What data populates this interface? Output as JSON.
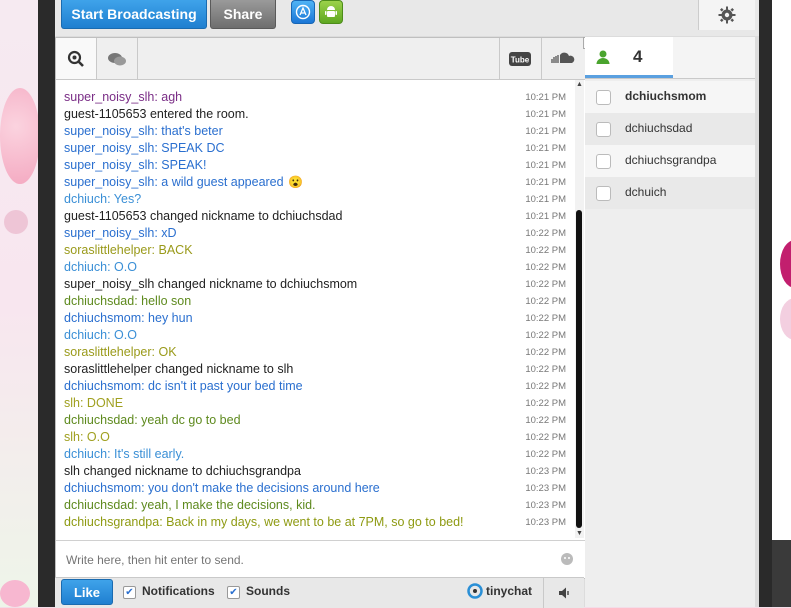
{
  "colors": {
    "accent_blue": "#1f7fd0",
    "guest_text": "#222222",
    "super_noisy_slh": "#7a2d86",
    "super_noisy_slh_blue": "#2a6fcf",
    "dchiuch": "#3a8fd6",
    "soraslittlehelper": "#9a9a1a",
    "dchiuchsdad": "#5e8a1e",
    "dchiuchsmom": "#2a6fcf",
    "slh": "#a0a020",
    "dchiuchsgrandpa": "#8e9a12"
  },
  "topbar": {
    "broadcast_label": "Start Broadcasting",
    "share_label": "Share",
    "apps": [
      "app-store-icon",
      "android-icon"
    ],
    "settings_icon": "gear-icon"
  },
  "chat_tabs": {
    "left": [
      "search-icon",
      "camera-icon"
    ],
    "right": [
      "youtube-icon",
      "soundcloud-icon"
    ],
    "youtube_label": "You Tube"
  },
  "messages": [
    {
      "text": "super_noisy_slh: agh",
      "time": "10:21 PM",
      "color": "#7a2d86"
    },
    {
      "text": "guest-1105653 entered the room.",
      "time": "10:21 PM",
      "color": "#222222"
    },
    {
      "text": "super_noisy_slh: that's beter",
      "time": "10:21 PM",
      "color": "#2a6fcf"
    },
    {
      "text": "super_noisy_slh: SPEAK DC",
      "time": "10:21 PM",
      "color": "#2a6fcf"
    },
    {
      "text": "super_noisy_slh: SPEAK!",
      "time": "10:21 PM",
      "color": "#2a6fcf"
    },
    {
      "text": "super_noisy_slh: a wild guest appeared",
      "time": "10:21 PM",
      "color": "#2a6fcf",
      "emoji": "😮"
    },
    {
      "text": "dchiuch: Yes?",
      "time": "10:21 PM",
      "color": "#3a8fd6"
    },
    {
      "text": "guest-1105653 changed nickname to dchiuchsdad",
      "time": "10:21 PM",
      "color": "#222222"
    },
    {
      "text": "super_noisy_slh: xD",
      "time": "10:22 PM",
      "color": "#2a6fcf"
    },
    {
      "text": "soraslittlehelper: BACK",
      "time": "10:22 PM",
      "color": "#9a9a1a"
    },
    {
      "text": "dchiuch: O.O",
      "time": "10:22 PM",
      "color": "#3a8fd6"
    },
    {
      "text": "super_noisy_slh changed nickname to dchiuchsmom",
      "time": "10:22 PM",
      "color": "#222222"
    },
    {
      "text": "dchiuchsdad: hello son",
      "time": "10:22 PM",
      "color": "#5e8a1e"
    },
    {
      "text": "dchiuchsmom: hey hun",
      "time": "10:22 PM",
      "color": "#2a6fcf"
    },
    {
      "text": "dchiuch: O.O",
      "time": "10:22 PM",
      "color": "#3a8fd6"
    },
    {
      "text": "soraslittlehelper: OK",
      "time": "10:22 PM",
      "color": "#9a9a1a"
    },
    {
      "text": "soraslittlehelper changed nickname to slh",
      "time": "10:22 PM",
      "color": "#222222"
    },
    {
      "text": "dchiuchsmom: dc isn't it past your bed time",
      "time": "10:22 PM",
      "color": "#2a6fcf"
    },
    {
      "text": "slh: DONE",
      "time": "10:22 PM",
      "color": "#a0a020"
    },
    {
      "text": "dchiuchsdad: yeah dc go to bed",
      "time": "10:22 PM",
      "color": "#5e8a1e"
    },
    {
      "text": "slh: O.O",
      "time": "10:22 PM",
      "color": "#a0a020"
    },
    {
      "text": "dchiuch: It's still early.",
      "time": "10:22 PM",
      "color": "#3a8fd6"
    },
    {
      "text": "slh changed nickname to dchiuchsgrandpa",
      "time": "10:23 PM",
      "color": "#222222"
    },
    {
      "text": "dchiuchsmom: you don't make the decisions around here",
      "time": "10:23 PM",
      "color": "#2a6fcf"
    },
    {
      "text": "dchiuchsdad: yeah, I make the decisions, kid.",
      "time": "10:23 PM",
      "color": "#5e8a1e"
    },
    {
      "text": "dchiuchsgrandpa: Back in my days, we went to be at 7PM, so go to bed!",
      "time": "10:23 PM",
      "color": "#8e9a12"
    }
  ],
  "input": {
    "placeholder": "Write here, then hit enter to send."
  },
  "bottombar": {
    "like_label": "Like",
    "notifications_label": "Notifications",
    "sounds_label": "Sounds",
    "brand_label": "tinychat",
    "notifications_checked": true,
    "sounds_checked": true
  },
  "userlist": {
    "count": "4",
    "users": [
      {
        "name": "dchiuchsmom",
        "bold": true
      },
      {
        "name": "dchiuchsdad",
        "bold": false
      },
      {
        "name": "dchiuchsgrandpa",
        "bold": false
      },
      {
        "name": "dchuich",
        "bold": false
      }
    ]
  }
}
